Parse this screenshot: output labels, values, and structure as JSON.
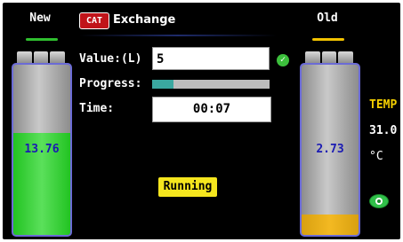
{
  "left_tank": {
    "header": "New",
    "header_bar_color": "#2fbf2f",
    "value": "13.76",
    "fill_fraction": 0.6,
    "fill_color": "#22c322"
  },
  "right_tank": {
    "header": "Old",
    "header_bar_color": "#f2c200",
    "value": "2.73",
    "fill_fraction": 0.12,
    "fill_color": "#f3b922"
  },
  "top": {
    "badge": "CAT",
    "title": "Exchange"
  },
  "form": {
    "value_label": "Value:(L)",
    "value_input": "5",
    "progress_label": "Progress:",
    "progress_fraction": 0.18,
    "time_label": "Time:",
    "time_value": "00:07"
  },
  "status": "Running",
  "temperature": {
    "label": "TEMP",
    "value": "31.0",
    "unit": "°C"
  },
  "icons": {
    "confirm": "check-circle-icon",
    "view": "eye-icon"
  }
}
